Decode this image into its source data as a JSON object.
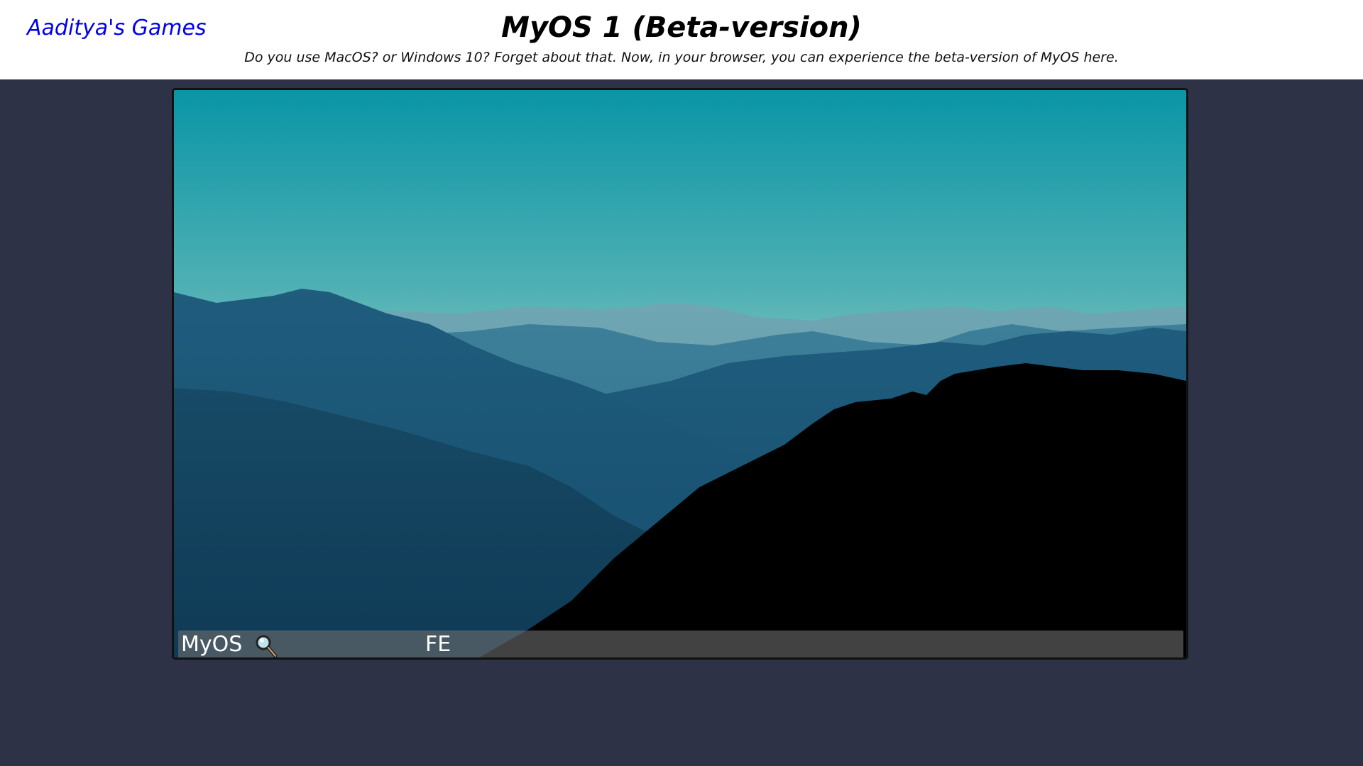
{
  "header": {
    "site_link": "Aaditya's Games",
    "title": "MyOS 1 (Beta-version)",
    "subtitle": "Do you use MacOS? or Windows 10? Forget about that. Now, in your browser, you can experience the beta-version of MyOS here."
  },
  "desktop": {
    "wallpaper": "mountain-landscape-wallpaper",
    "taskbar": {
      "start_label": "MyOS",
      "search_icon": "magnifier-icon",
      "file_explorer_label": "FE"
    }
  },
  "colors": {
    "page_background": "#2e3246",
    "link": "#0000ee",
    "sky_top": "#0a9aa9",
    "sky_bottom": "#9cd0c9",
    "mountain_dark": "#0d3a55",
    "forest_silhouette": "#000000",
    "taskbar": "#6e6e6e"
  }
}
